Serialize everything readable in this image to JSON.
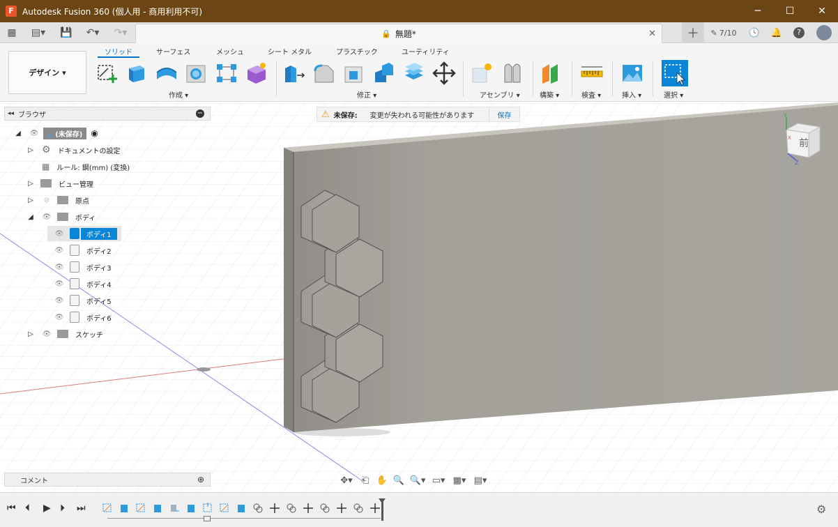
{
  "titlebar": {
    "app_icon": "F",
    "title": "Autodesk Fusion 360 (個人用 - 商用利用不可)"
  },
  "window_controls": {
    "minimize": "─",
    "maximize": "☐",
    "close": "✕"
  },
  "quickbar": {
    "grid": "▦",
    "file": "▤▾",
    "save": "💾",
    "undo": "↶▾",
    "redo": "↷▾"
  },
  "document_tab": {
    "title": "無題*",
    "lock": "🔒",
    "close": "✕"
  },
  "topright": {
    "new_tab": "＋",
    "jobs_count": "7/10",
    "clock": "🕓",
    "bell": "🔔",
    "help": "?",
    "avatar": "●"
  },
  "workspace": {
    "label": "デザイン ▾"
  },
  "ribbon_tabs": [
    "ソリッド",
    "サーフェス",
    "メッシュ",
    "シート メタル",
    "プラスチック",
    "ユーティリティ"
  ],
  "ribbon_groups": [
    "作成 ▾",
    "修正 ▾",
    "アセンブリ ▾",
    "構築 ▾",
    "検査 ▾",
    "挿入 ▾",
    "選択 ▾"
  ],
  "browser": {
    "title": "ブラウザ",
    "collapse": "◂◂",
    "minus": "−",
    "root": "(未保存)",
    "items": [
      {
        "label": "ドキュメントの設定"
      },
      {
        "label": "ルール: 鋼(mm) (変換)"
      },
      {
        "label": "ビュー管理"
      },
      {
        "label": "原点"
      },
      {
        "label": "ボディ"
      },
      {
        "label": "ボディ1"
      },
      {
        "label": "ボディ2"
      },
      {
        "label": "ボディ3"
      },
      {
        "label": "ボディ4"
      },
      {
        "label": "ボディ5"
      },
      {
        "label": "ボディ6"
      },
      {
        "label": "スケッチ"
      }
    ]
  },
  "warning": {
    "icon": "⚠",
    "title": "未保存:",
    "message": "変更が失われる可能性があります",
    "save": "保存"
  },
  "viewcube": {
    "face_label": "前",
    "axis_x": "X",
    "axis_y": "Y",
    "axis_z": "Z"
  },
  "comments": {
    "label": "コメント",
    "plus": "⊕"
  },
  "navbar": [
    "✥▾",
    "⎗",
    "✋",
    "🔍",
    "🔍▾",
    "▭▾",
    "▦▾",
    "▤▾"
  ],
  "timeline": {
    "first": "⏮",
    "prev": "⏴",
    "play": "▶",
    "next": "⏵",
    "last": "⏭",
    "settings": "⚙"
  },
  "colors": {
    "titlebar": "#6b4513",
    "accent": "#0073c7",
    "selection": "#0a86d8",
    "plate": "#a29f98",
    "hex": "#a9a6a0"
  }
}
